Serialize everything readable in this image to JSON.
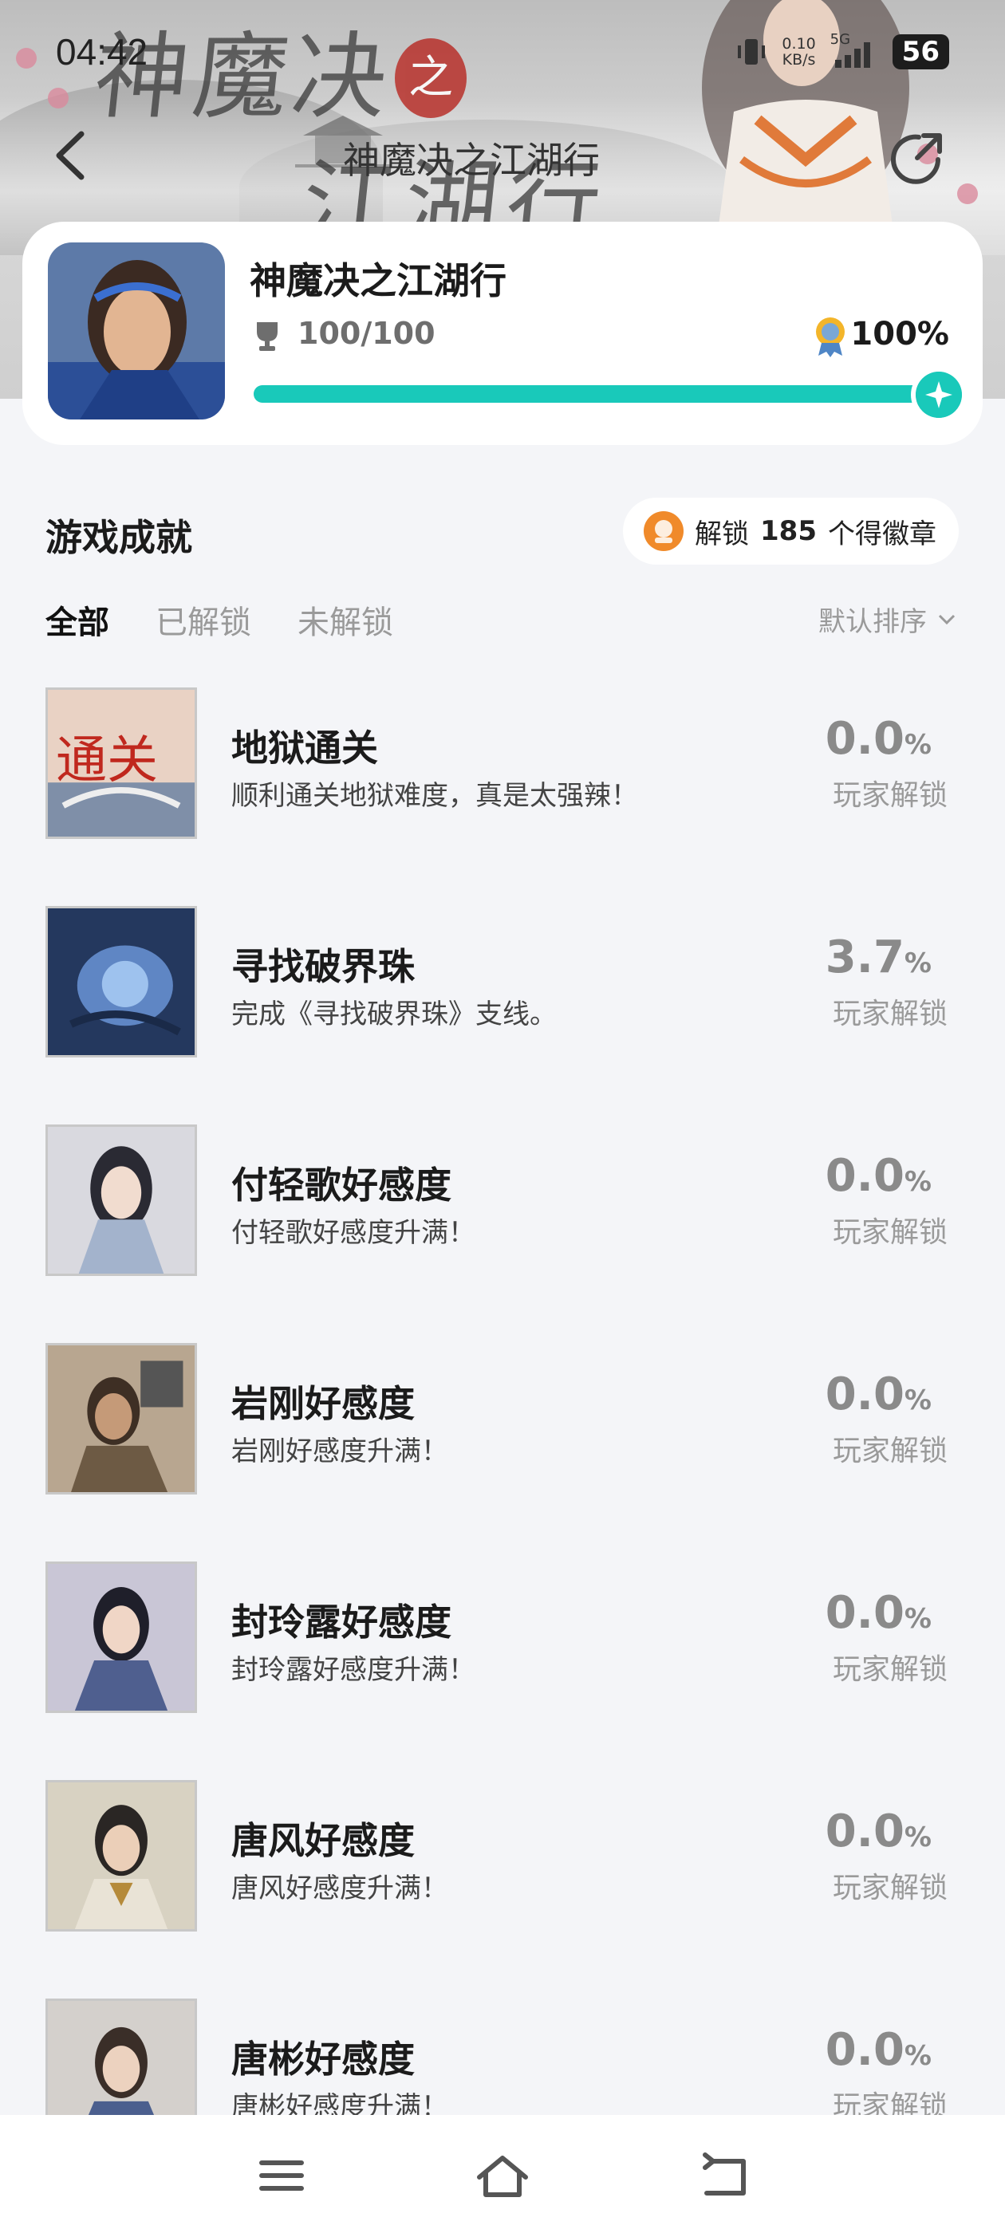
{
  "status_bar": {
    "time": "04:42",
    "net_speed": "0.10",
    "net_unit": "KB/s",
    "signal": "5G",
    "battery": "56"
  },
  "header": {
    "title": "神魔决之江湖行",
    "banner_text_top": "神魔决",
    "banner_seal": "之",
    "banner_text_bottom": "江湖行"
  },
  "game": {
    "name": "神魔决之江湖行",
    "progress": "100/100",
    "percent": "100%",
    "completion_fraction": 1.0
  },
  "section": {
    "title": "游戏成就",
    "unlock_prefix": "解锁",
    "unlock_count": "185",
    "unlock_suffix": "个得徽章"
  },
  "tabs": [
    {
      "label": "全部",
      "active": true
    },
    {
      "label": "已解锁"
    },
    {
      "label": "未解锁"
    }
  ],
  "sort": {
    "label": "默认排序"
  },
  "achievements": [
    {
      "title": "地狱通关",
      "desc": "顺利通关地狱难度，真是太强辣！",
      "pct": "0.0",
      "unit": "%",
      "label": "玩家解锁",
      "thumb_text": "通关",
      "thumb_colors": [
        "#e9d2c4",
        "#7f8fa8"
      ]
    },
    {
      "title": "寻找破界珠",
      "desc": "完成《寻找破界珠》支线。",
      "pct": "3.7",
      "unit": "%",
      "label": "玩家解锁",
      "thumb_colors": [
        "#24385e",
        "#5f86c4"
      ]
    },
    {
      "title": "付轻歌好感度",
      "desc": "付轻歌好感度升满！",
      "pct": "0.0",
      "unit": "%",
      "label": "玩家解锁",
      "thumb_colors": [
        "#d9d9df",
        "#a3b3cc"
      ]
    },
    {
      "title": "岩刚好感度",
      "desc": "岩刚好感度升满！",
      "pct": "0.0",
      "unit": "%",
      "label": "玩家解锁",
      "thumb_colors": [
        "#b8a690",
        "#6d5a44"
      ]
    },
    {
      "title": "封玲露好感度",
      "desc": "封玲露好感度升满！",
      "pct": "0.0",
      "unit": "%",
      "label": "玩家解锁",
      "thumb_colors": [
        "#c9c6d6",
        "#4f5f8f"
      ]
    },
    {
      "title": "唐风好感度",
      "desc": "唐风好感度升满！",
      "pct": "0.0",
      "unit": "%",
      "label": "玩家解锁",
      "thumb_colors": [
        "#d8d2c2",
        "#b58a3a"
      ]
    },
    {
      "title": "唐彬好感度",
      "desc": "唐彬好感度升满！",
      "pct": "0.0",
      "unit": "%",
      "label": "玩家解锁",
      "thumb_colors": [
        "#d4d0cc",
        "#4b5f8e"
      ]
    }
  ],
  "colors": {
    "accent": "#19c9ba",
    "badge": "#f08a2a"
  }
}
